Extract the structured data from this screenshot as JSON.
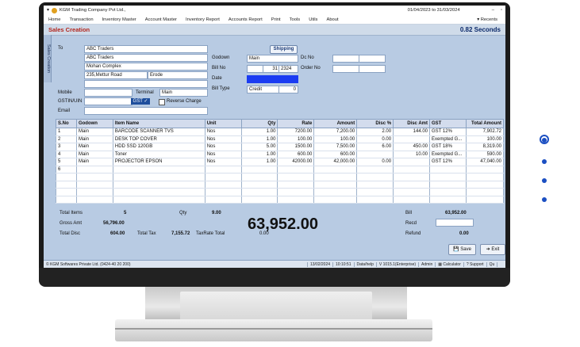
{
  "window": {
    "company": "KGM Trading Company Pvt Ltd.,",
    "period": "01/04/2023 to 31/03/2024",
    "recents": "▾ Recents"
  },
  "menu": [
    "Home",
    "Transaction",
    "Inventory Master",
    "Account Master",
    "Inventory Report",
    "Accounts Report",
    "Print",
    "Tools",
    "Utils",
    "About"
  ],
  "header": {
    "title": "Sales Creation",
    "timer": "0.82 Seconds"
  },
  "sidetab": "Sales Creation",
  "form": {
    "to_label": "To",
    "to_lines": [
      "ABC Traders",
      "ABC Traders",
      "Mohan Complex",
      "235,Mettur Road"
    ],
    "city": "Erode",
    "mobile_label": "Mobile",
    "terminal_label": "Terminal",
    "terminal_value": "Main",
    "gstin_label": "GSTIN/UIN",
    "gst_button": "GST ✓",
    "reverse_charge": "Reverse Charge",
    "email_label": "Email",
    "shipping": "Shipping",
    "godown_label": "Godown",
    "godown_value": "Main",
    "billno_label": "Bill No",
    "billno_value": "31",
    "billno_suffix": "2324",
    "date_label": "Date",
    "billtype_label": "Bill Type",
    "billtype_value": "Credit",
    "billtype_num": "0",
    "dcno_label": "Dc No",
    "orderno_label": "Order No"
  },
  "table": {
    "headers": [
      "S.No",
      "Godown",
      "Item Name",
      "Unit",
      "Qty",
      "Rate",
      "Amount",
      "Disc %",
      "Disc Amt",
      "GST",
      "Total Amount"
    ],
    "rows": [
      [
        "1",
        "Main",
        "BARCODE SCANNER TVS",
        "Nos",
        "1.00",
        "7200.00",
        "7,200.00",
        "2.00",
        "144.00",
        "GST 12%",
        "7,902.72"
      ],
      [
        "2",
        "Main",
        "DESK TOP COVER",
        "Nos",
        "1.00",
        "100.00",
        "100.00",
        "0.00",
        "",
        "Exempted G...",
        "100.00"
      ],
      [
        "3",
        "Main",
        "HDD SSD 120GB",
        "Nos",
        "5.00",
        "1500.00",
        "7,500.00",
        "6.00",
        "450.00",
        "GST 18%",
        "8,319.00"
      ],
      [
        "4",
        "Main",
        "Toner",
        "Nos",
        "1.00",
        "600.00",
        "600.00",
        "",
        "10.00",
        "Exempted G...",
        "590.00"
      ],
      [
        "5",
        "Main",
        "PROJECTOR EPSON",
        "Nos",
        "1.00",
        "42000.00",
        "42,000.00",
        "0.00",
        "",
        "GST 12%",
        "47,040.00"
      ],
      [
        "6",
        "",
        "",
        "",
        "",
        "",
        "",
        "",
        "",
        "",
        ""
      ]
    ]
  },
  "totals": {
    "total_items_label": "Total Items",
    "total_items": "5",
    "qty_label": "Qty",
    "qty": "9.00",
    "gross_label": "Gross Amt",
    "gross": "56,796.00",
    "disc_label": "Total Disc",
    "disc": "604.00",
    "tax_label": "Total Tax",
    "tax": "7,155.72",
    "taxable_label": "TaxRate Total",
    "taxable": "0.00",
    "grand": "63,952.00",
    "bill_label": "Bill",
    "bill": "63,952.00",
    "recd_label": "Recd",
    "refund_label": "Refund",
    "refund": "0.00"
  },
  "buttons": {
    "save": "Save",
    "exit": "Exit"
  },
  "status": {
    "company": "© KGM Softwares Private Ltd. (0424-40 20 200)",
    "date": "13/02/2024",
    "time": "10:10:51",
    "db": "Data/help",
    "version": "V 1015.1(Enterprise)",
    "user": "Admin",
    "calc": "Calculator",
    "support": "Support",
    "qu": "Qu"
  },
  "colors": {
    "accent": "#1b4fc2",
    "title_red": "#b3261e"
  }
}
